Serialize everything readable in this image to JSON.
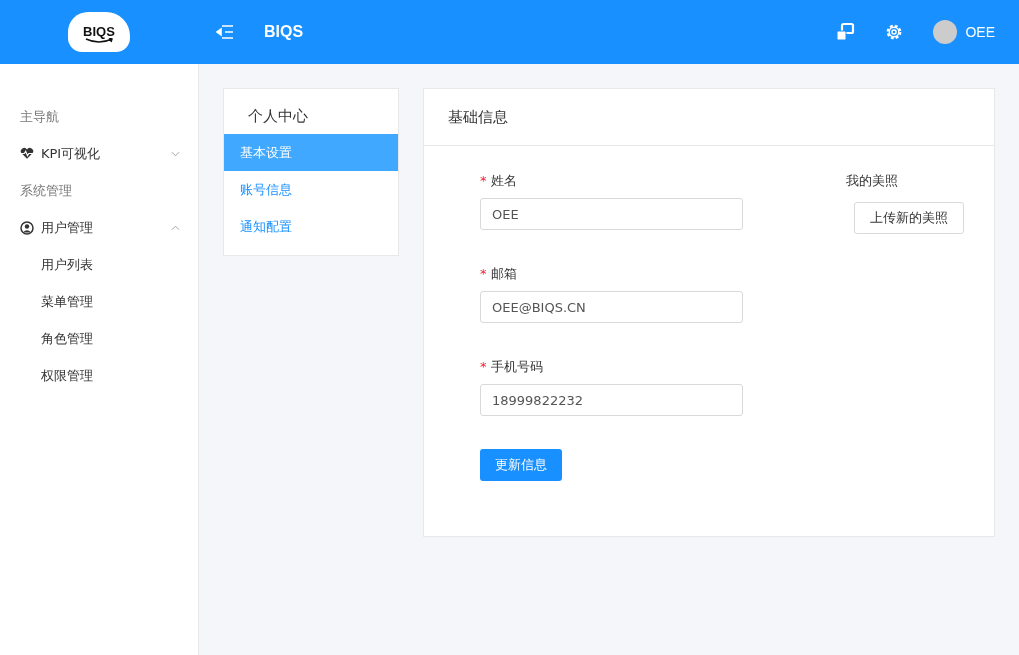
{
  "header": {
    "logo_text": "BIQS",
    "title": "BIQS",
    "user": "OEE"
  },
  "sidebar": {
    "sections": [
      {
        "label": "主导航",
        "items": [
          {
            "label": "KPI可视化",
            "expanded": false
          }
        ]
      },
      {
        "label": "系统管理",
        "items": [
          {
            "label": "用户管理",
            "expanded": true,
            "children": [
              {
                "label": "用户列表"
              },
              {
                "label": "菜单管理"
              },
              {
                "label": "角色管理"
              },
              {
                "label": "权限管理"
              }
            ]
          }
        ]
      }
    ]
  },
  "profile_menu": {
    "title": "个人中心",
    "tabs": [
      {
        "label": "基本设置",
        "selected": true
      },
      {
        "label": "账号信息",
        "selected": false
      },
      {
        "label": "通知配置",
        "selected": false
      }
    ]
  },
  "basic_info": {
    "title": "基础信息",
    "fields": [
      {
        "label": "姓名",
        "required_mark": "*",
        "value": "OEE"
      },
      {
        "label": "邮箱",
        "required_mark": "*",
        "value": "OEE@BIQS.CN"
      },
      {
        "label": "手机号码",
        "required_mark": "*",
        "value": "18999822232"
      }
    ],
    "submit": "更新信息",
    "photo_label": "我的美照",
    "upload": "上传新的美照"
  }
}
